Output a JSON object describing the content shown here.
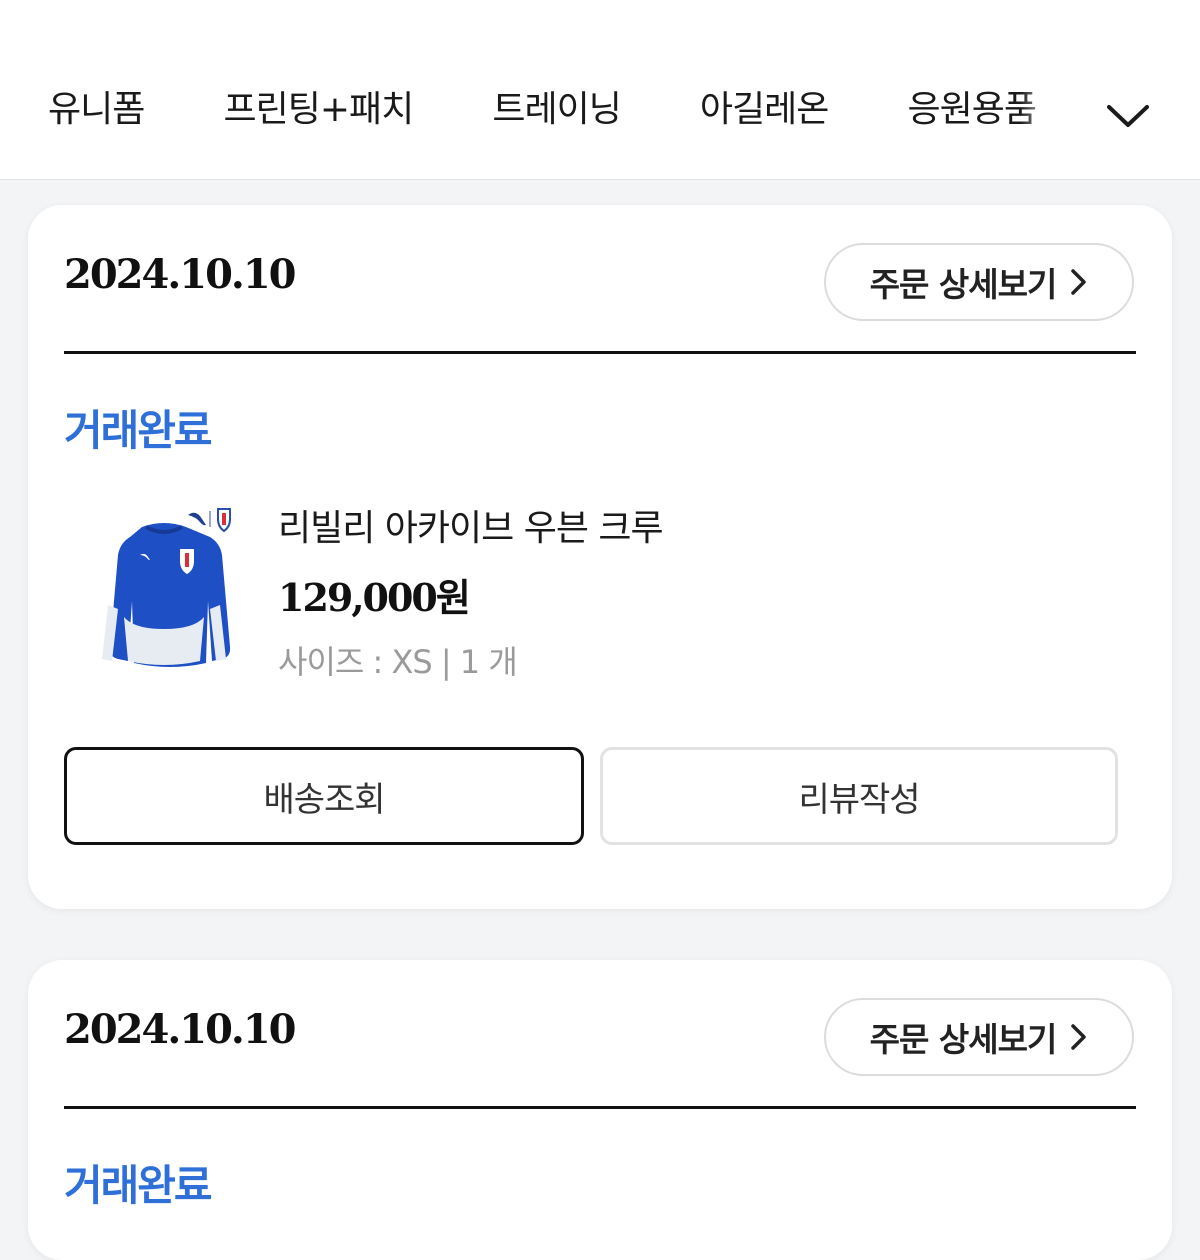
{
  "nav": {
    "categories": [
      "유니폼",
      "프린팅+패치",
      "트레이닝",
      "아길레온",
      "응원용품"
    ],
    "more_icon": "chevron-down-icon"
  },
  "orders": [
    {
      "date": "2024.10.10",
      "detail_label": "주문 상세보기",
      "detail_icon": "chevron-right-icon",
      "status": "거래완료",
      "product": {
        "name": "리빌리 아카이브 우븐 크루",
        "price": "129,000원",
        "option": "사이즈 : XS | 1 개"
      },
      "track_label": "배송조회",
      "review_label": "리뷰작성"
    },
    {
      "date": "2024.10.10",
      "detail_label": "주문 상세보기",
      "detail_icon": "chevron-right-icon",
      "status": "거래완료"
    }
  ],
  "colors": {
    "status": "#2e6fd8",
    "jacket_blue": "#1f4fc4",
    "page_bg": "#f3f4f6"
  }
}
